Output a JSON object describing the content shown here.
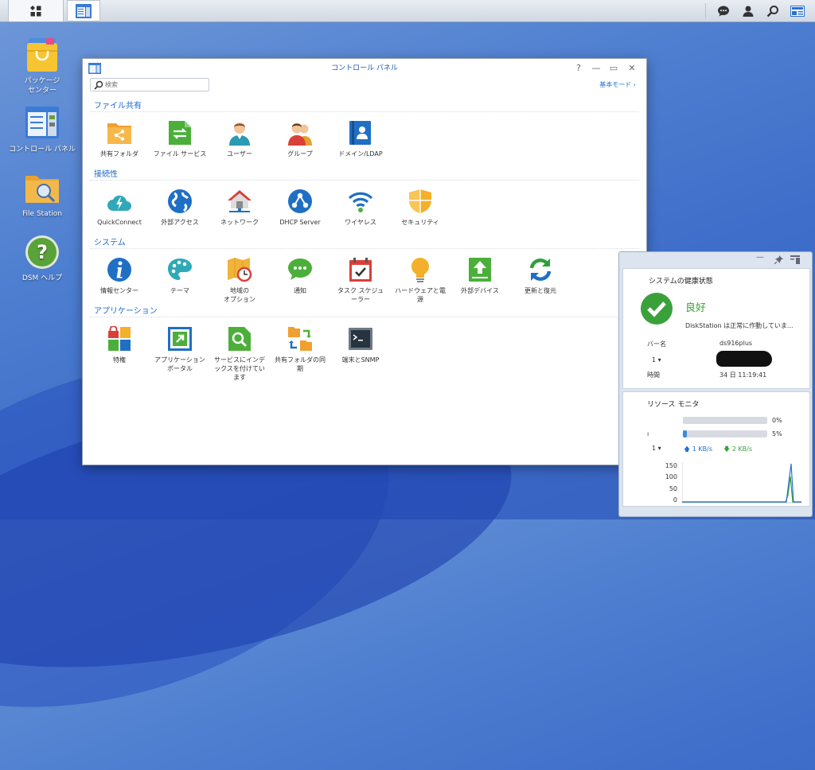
{
  "taskbar": {
    "main_menu_icon": "main-menu-icon",
    "open_app_icon": "control-panel-icon",
    "right_icons": [
      "chat-icon",
      "user-icon",
      "search-icon",
      "widgets-icon"
    ]
  },
  "desktop": {
    "icons": [
      {
        "label": "パッケージ\nセンター",
        "icon": "package-center-icon"
      },
      {
        "label": "コントロール パネル",
        "icon": "control-panel-icon"
      },
      {
        "label": "File Station",
        "icon": "file-station-icon"
      },
      {
        "label": "DSM ヘルプ",
        "icon": "help-icon"
      }
    ]
  },
  "window": {
    "title": "コントロール パネル",
    "controls": [
      "?",
      "—",
      "▭",
      "✕"
    ],
    "search_placeholder": "検索",
    "basic_mode": "基本モード",
    "sections": [
      {
        "title": "ファイル共有",
        "items": [
          "共有フォルダ",
          "ファイル サービス",
          "ユーザー",
          "グループ",
          "ドメイン/LDAP"
        ]
      },
      {
        "title": "接続性",
        "items": [
          "QuickConnect",
          "外部アクセス",
          "ネットワーク",
          "DHCP Server",
          "ワイヤレス",
          "セキュリティ"
        ]
      },
      {
        "title": "システム",
        "items": [
          "情報センター",
          "テーマ",
          "地域の\nオプション",
          "通知",
          "タスク スケジュ\nーラー",
          "ハードウェアと電\n源",
          "外部デバイス",
          "更新と復元"
        ]
      },
      {
        "title": "アプリケーション",
        "items": [
          "特権",
          "アプリケーション\nポータル",
          "サービスにインデ\nックスを付けてい\nます",
          "共有フォルダの同\n期",
          "端末とSNMP"
        ]
      }
    ]
  },
  "widgets": {
    "health": {
      "title": "システムの健康状態",
      "status": "良好",
      "message": "DiskStation は正常に作動していま...",
      "server_label": "バー名",
      "server_value": "ds916plus",
      "row2_label": "1 ▾",
      "time_label": "時間",
      "time_value": "34 日 11:19:41"
    },
    "resource": {
      "title": "リソース モニタ",
      "cpu_percent": "0%",
      "ram_percent": "5%",
      "cpu_value": 0,
      "ram_value": 5,
      "lan_label": "1 ▾",
      "upload": "1 KB/s",
      "download": "2 KB/s",
      "y_ticks": [
        "150",
        "100",
        "50",
        "0"
      ]
    }
  }
}
